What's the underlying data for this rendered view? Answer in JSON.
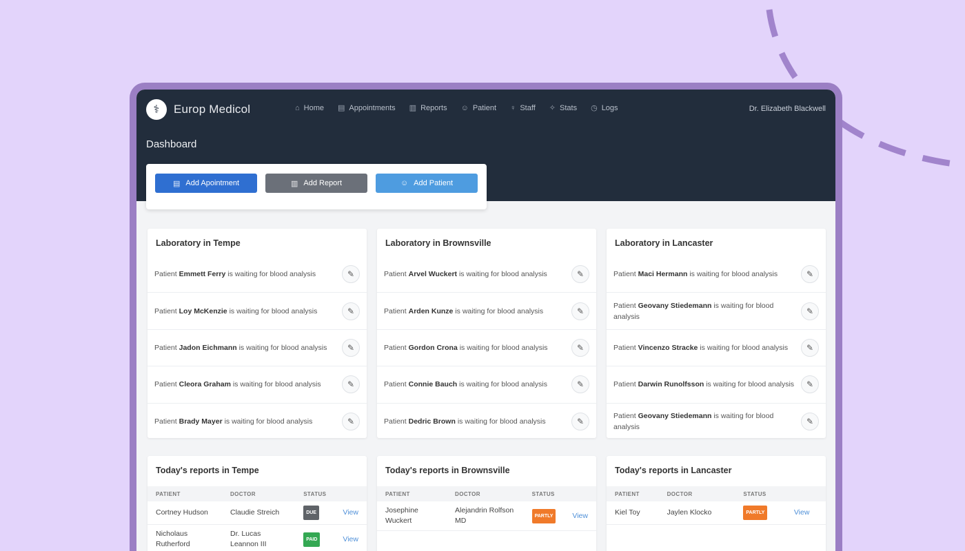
{
  "app": {
    "logo_glyph": "⚕",
    "name": "Europ Medicol",
    "user": "Dr. Elizabeth Blackwell"
  },
  "nav": [
    {
      "label": "Home",
      "icon": "⌂"
    },
    {
      "label": "Appointments",
      "icon": "▤"
    },
    {
      "label": "Reports",
      "icon": "▥"
    },
    {
      "label": "Patient",
      "icon": "☺"
    },
    {
      "label": "Staff",
      "icon": "♀"
    },
    {
      "label": "Stats",
      "icon": "✧"
    },
    {
      "label": "Logs",
      "icon": "◷"
    }
  ],
  "page": {
    "title": "Dashboard"
  },
  "actions": {
    "add_appointment": "Add Apointment",
    "add_report": "Add Report",
    "add_patient": "Add Patient"
  },
  "labs": [
    {
      "title": "Laboratory in Tempe",
      "items": [
        {
          "prefix": "Patient",
          "name": "Emmett Ferry",
          "suffix": "is waiting for blood analysis"
        },
        {
          "prefix": "Patient",
          "name": "Loy McKenzie",
          "suffix": "is waiting for blood analysis"
        },
        {
          "prefix": "Patient",
          "name": "Jadon Eichmann",
          "suffix": "is waiting for blood analysis"
        },
        {
          "prefix": "Patient",
          "name": "Cleora Graham",
          "suffix": "is waiting for blood analysis"
        },
        {
          "prefix": "Patient",
          "name": "Brady Mayer",
          "suffix": "is waiting for blood analysis"
        }
      ]
    },
    {
      "title": "Laboratory in Brownsville",
      "items": [
        {
          "prefix": "Patient",
          "name": "Arvel Wuckert",
          "suffix": "is waiting for blood analysis"
        },
        {
          "prefix": "Patient",
          "name": "Arden Kunze",
          "suffix": "is waiting for blood analysis"
        },
        {
          "prefix": "Patient",
          "name": "Gordon Crona",
          "suffix": "is waiting for blood analysis"
        },
        {
          "prefix": "Patient",
          "name": "Connie Bauch",
          "suffix": "is waiting for blood analysis"
        },
        {
          "prefix": "Patient",
          "name": "Dedric Brown",
          "suffix": "is waiting for blood analysis"
        }
      ]
    },
    {
      "title": "Laboratory in Lancaster",
      "items": [
        {
          "prefix": "Patient",
          "name": "Maci Hermann",
          "suffix": "is waiting for blood analysis"
        },
        {
          "prefix": "Patient",
          "name": "Geovany Stiedemann",
          "suffix": "is waiting for blood analysis"
        },
        {
          "prefix": "Patient",
          "name": "Vincenzo Stracke",
          "suffix": "is waiting for blood analysis"
        },
        {
          "prefix": "Patient",
          "name": "Darwin Runolfsson",
          "suffix": "is waiting for blood analysis"
        },
        {
          "prefix": "Patient",
          "name": "Geovany Stiedemann",
          "suffix": "is waiting for blood analysis"
        }
      ]
    }
  ],
  "reports": [
    {
      "title": "Today's reports in Tempe",
      "columns": [
        "PATIENT",
        "DOCTOR",
        "STATUS"
      ],
      "rows": [
        {
          "patient": "Cortney Hudson",
          "doctor": "Claudie Streich",
          "status": "DUE",
          "status_color": "#5f6368",
          "action": "View"
        },
        {
          "patient": "Nicholaus Rutherford",
          "doctor": "Dr. Lucas Leannon III",
          "status": "PAID",
          "status_color": "#34a853",
          "action": "View"
        }
      ]
    },
    {
      "title": "Today's reports in Brownsville",
      "columns": [
        "PATIENT",
        "DOCTOR",
        "STATUS"
      ],
      "rows": [
        {
          "patient": "Josephine Wuckert",
          "doctor": "Alejandrin Rolfson MD",
          "status": "PARTLY",
          "status_color": "#f07a2a",
          "action": "View"
        }
      ]
    },
    {
      "title": "Today's reports in Lancaster",
      "columns": [
        "PATIENT",
        "DOCTOR",
        "STATUS"
      ],
      "rows": [
        {
          "patient": "Kiel Toy",
          "doctor": "Jaylen Klocko",
          "status": "PARTLY",
          "status_color": "#f07a2a",
          "action": "View"
        }
      ]
    }
  ],
  "icons": {
    "edit": "edit-icon",
    "edit_glyph": "✎",
    "appointment_glyph": "▤",
    "report_glyph": "▥",
    "patient_glyph": "☺"
  }
}
